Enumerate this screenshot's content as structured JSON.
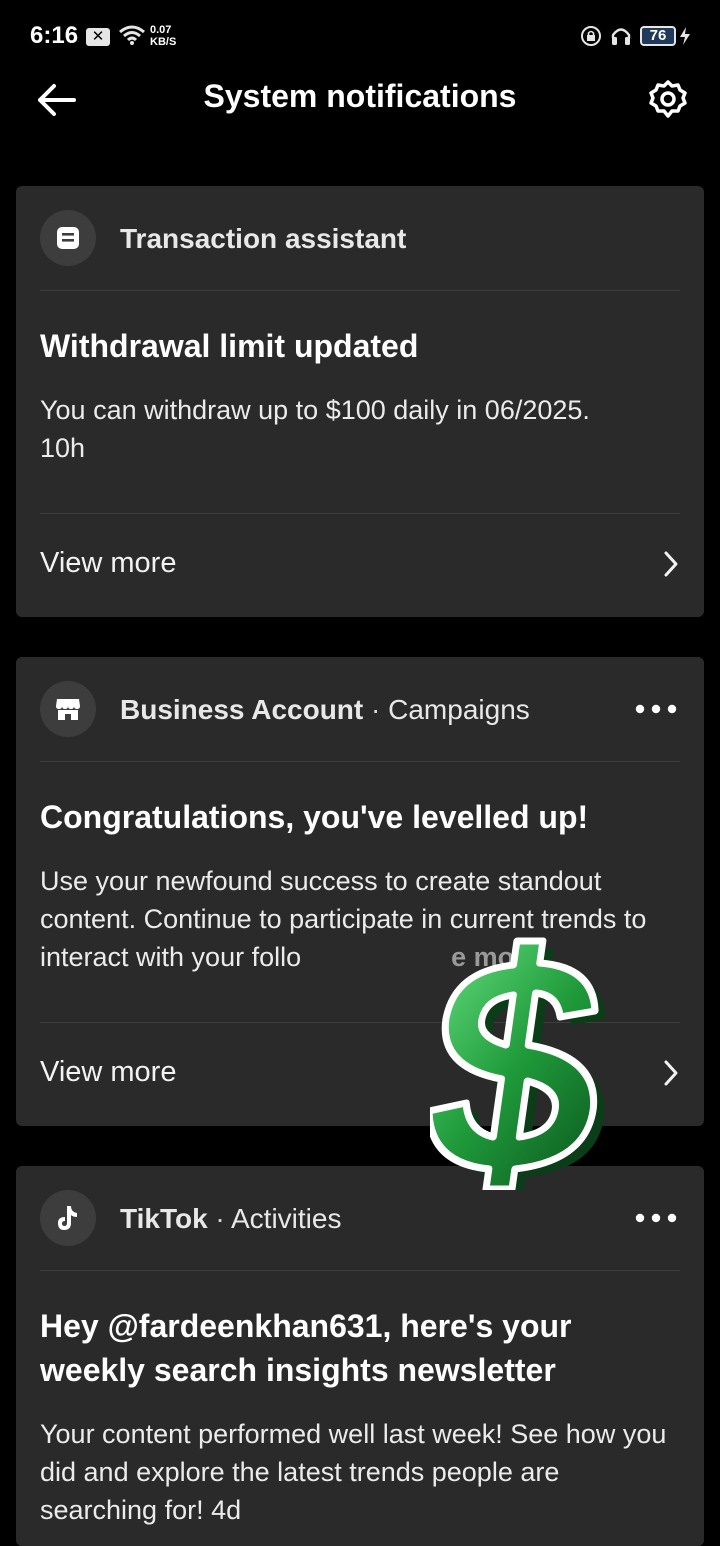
{
  "status_bar": {
    "time": "6:16",
    "net_speed_value": "0.07",
    "net_speed_unit": "KB/S",
    "battery": "76"
  },
  "header": {
    "title": "System notifications"
  },
  "cards": [
    {
      "source": "Transaction assistant",
      "category": "",
      "title": "Withdrawal limit updated",
      "body": "You can withdraw up to $100 daily in 06/2025.",
      "time": "10h",
      "view_more": "View more"
    },
    {
      "source": "Business Account",
      "separator": " · ",
      "category": "Campaigns",
      "title": "Congratulations, you've levelled up!",
      "body": "Use your newfound success to create standout content. Continue to participate in current trends to interact with your follo",
      "see_more": "e more",
      "view_more": "View more"
    },
    {
      "source": "TikTok",
      "separator": " · ",
      "category": "Activities",
      "title": "Hey @fardeenkhan631, here's your weekly search insights newsletter",
      "body": "Your content performed well last week! See how you did and explore the latest trends people are searching for!",
      "time": "4d"
    }
  ],
  "colors": {
    "background": "#000000",
    "card": "#2a2a2b",
    "sticker_green": "#1f9a3a"
  }
}
